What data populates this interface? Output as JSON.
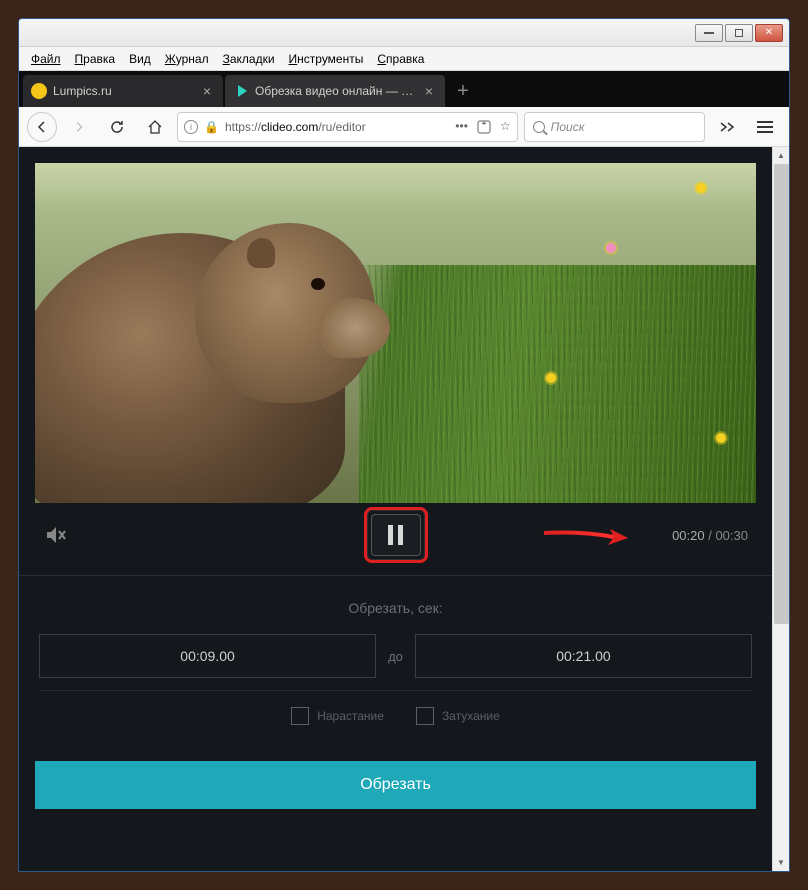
{
  "menus": {
    "file": "Файл",
    "edit": "Правка",
    "view": "Вид",
    "history": "Журнал",
    "bookmarks": "Закладки",
    "tools": "Инструменты",
    "help": "Справка"
  },
  "tabs": [
    {
      "title": "Lumpics.ru"
    },
    {
      "title": "Обрезка видео онлайн — Обр"
    }
  ],
  "url": {
    "proto": "https://",
    "host": "clideo.com",
    "path": "/ru/editor"
  },
  "search": {
    "placeholder": "Поиск"
  },
  "player": {
    "current_time": "00:20",
    "total_time": "00:30"
  },
  "cut": {
    "label": "Обрезать, сек:",
    "from": "00:09.00",
    "to_label": "до",
    "to": "00:21.00"
  },
  "fade": {
    "in": "Нарастание",
    "out": "Затухание"
  },
  "action": {
    "label": "Обрезать"
  }
}
